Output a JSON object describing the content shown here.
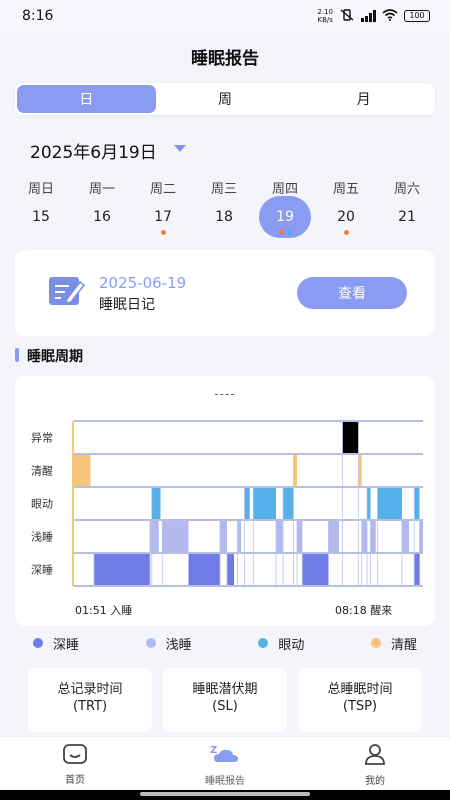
{
  "status": {
    "time": "8:16",
    "net_speed_top": "2.10",
    "net_speed_bottom": "KB/s",
    "battery": "100"
  },
  "header": {
    "title": "睡眠报告"
  },
  "tabs": [
    {
      "label": "日",
      "active": true
    },
    {
      "label": "周",
      "active": false
    },
    {
      "label": "月",
      "active": false
    }
  ],
  "date_picker": {
    "label": "2025年6月19日"
  },
  "week": [
    {
      "name": "周日",
      "day": "15",
      "dots": []
    },
    {
      "name": "周一",
      "day": "16",
      "dots": []
    },
    {
      "name": "周二",
      "day": "17",
      "dots": [
        "#f07b3f"
      ]
    },
    {
      "name": "周三",
      "day": "18",
      "dots": []
    },
    {
      "name": "周四",
      "day": "19",
      "dots": [
        "#f07b3f",
        "#4dabf7"
      ],
      "selected": true
    },
    {
      "name": "周五",
      "day": "20",
      "dots": [
        "#f07b3f"
      ]
    },
    {
      "name": "周六",
      "day": "21",
      "dots": []
    }
  ],
  "diary": {
    "date": "2025-06-19",
    "label": "睡眠日记",
    "button": "查看"
  },
  "section": {
    "title": "睡眠周期"
  },
  "chart_data": {
    "type": "hypnogram",
    "title": "----",
    "rows": [
      "异常",
      "清醒",
      "眼动",
      "浅睡",
      "深睡"
    ],
    "start_label": "01:51 入睡",
    "end_label": "08:18 醒来",
    "time_range": [
      0,
      1
    ],
    "colors": {
      "异常": "#000000",
      "清醒": "#f5c57a",
      "眼动": "#56b0ea",
      "浅睡": "#b3b9f0",
      "深睡": "#6f7ce8"
    },
    "segments": [
      {
        "stage": "清醒",
        "start": 0.0,
        "end": 0.05
      },
      {
        "stage": "深睡",
        "start": 0.06,
        "end": 0.22
      },
      {
        "stage": "浅睡",
        "start": 0.22,
        "end": 0.245
      },
      {
        "stage": "眼动",
        "start": 0.225,
        "end": 0.25
      },
      {
        "stage": "浅睡",
        "start": 0.255,
        "end": 0.33
      },
      {
        "stage": "深睡",
        "start": 0.33,
        "end": 0.42
      },
      {
        "stage": "浅睡",
        "start": 0.42,
        "end": 0.44
      },
      {
        "stage": "深睡",
        "start": 0.44,
        "end": 0.46
      },
      {
        "stage": "浅睡",
        "start": 0.47,
        "end": 0.48
      },
      {
        "stage": "眼动",
        "start": 0.49,
        "end": 0.505
      },
      {
        "stage": "眼动",
        "start": 0.515,
        "end": 0.58
      },
      {
        "stage": "浅睡",
        "start": 0.58,
        "end": 0.6
      },
      {
        "stage": "眼动",
        "start": 0.6,
        "end": 0.63
      },
      {
        "stage": "清醒",
        "start": 0.63,
        "end": 0.64
      },
      {
        "stage": "浅睡",
        "start": 0.64,
        "end": 0.655
      },
      {
        "stage": "深睡",
        "start": 0.655,
        "end": 0.73
      },
      {
        "stage": "浅睡",
        "start": 0.73,
        "end": 0.76
      },
      {
        "stage": "异常",
        "start": 0.77,
        "end": 0.815
      },
      {
        "stage": "清醒",
        "start": 0.815,
        "end": 0.825
      },
      {
        "stage": "浅睡",
        "start": 0.825,
        "end": 0.84
      },
      {
        "stage": "眼动",
        "start": 0.84,
        "end": 0.85
      },
      {
        "stage": "浅睡",
        "start": 0.85,
        "end": 0.865
      },
      {
        "stage": "眼动",
        "start": 0.87,
        "end": 0.94
      },
      {
        "stage": "浅睡",
        "start": 0.94,
        "end": 0.96
      },
      {
        "stage": "浅睡",
        "start": 0.99,
        "end": 1.0
      },
      {
        "stage": "眼动",
        "start": 0.975,
        "end": 0.99
      },
      {
        "stage": "深睡",
        "start": 0.975,
        "end": 0.99
      }
    ]
  },
  "legend": [
    {
      "label": "深睡",
      "color": "#6f7ce8"
    },
    {
      "label": "浅睡",
      "color": "#b3b9f0"
    },
    {
      "label": "眼动",
      "color": "#56b0ea"
    },
    {
      "label": "清醒",
      "color": "#f5c57a"
    }
  ],
  "stats": [
    {
      "line1": "总记录时间",
      "line2": "(TRT)"
    },
    {
      "line1": "睡眠潜伏期",
      "line2": "(SL)"
    },
    {
      "line1": "总睡眠时间",
      "line2": "(TSP)"
    }
  ],
  "nav": [
    {
      "label": "首页",
      "icon": "home-icon",
      "active": false
    },
    {
      "label": "睡眠报告",
      "icon": "sleep-report-icon",
      "active": true
    },
    {
      "label": "我的",
      "icon": "profile-icon",
      "active": false
    }
  ],
  "colors": {
    "accent": "#8a9cf2",
    "background": "#f3f5fb"
  }
}
